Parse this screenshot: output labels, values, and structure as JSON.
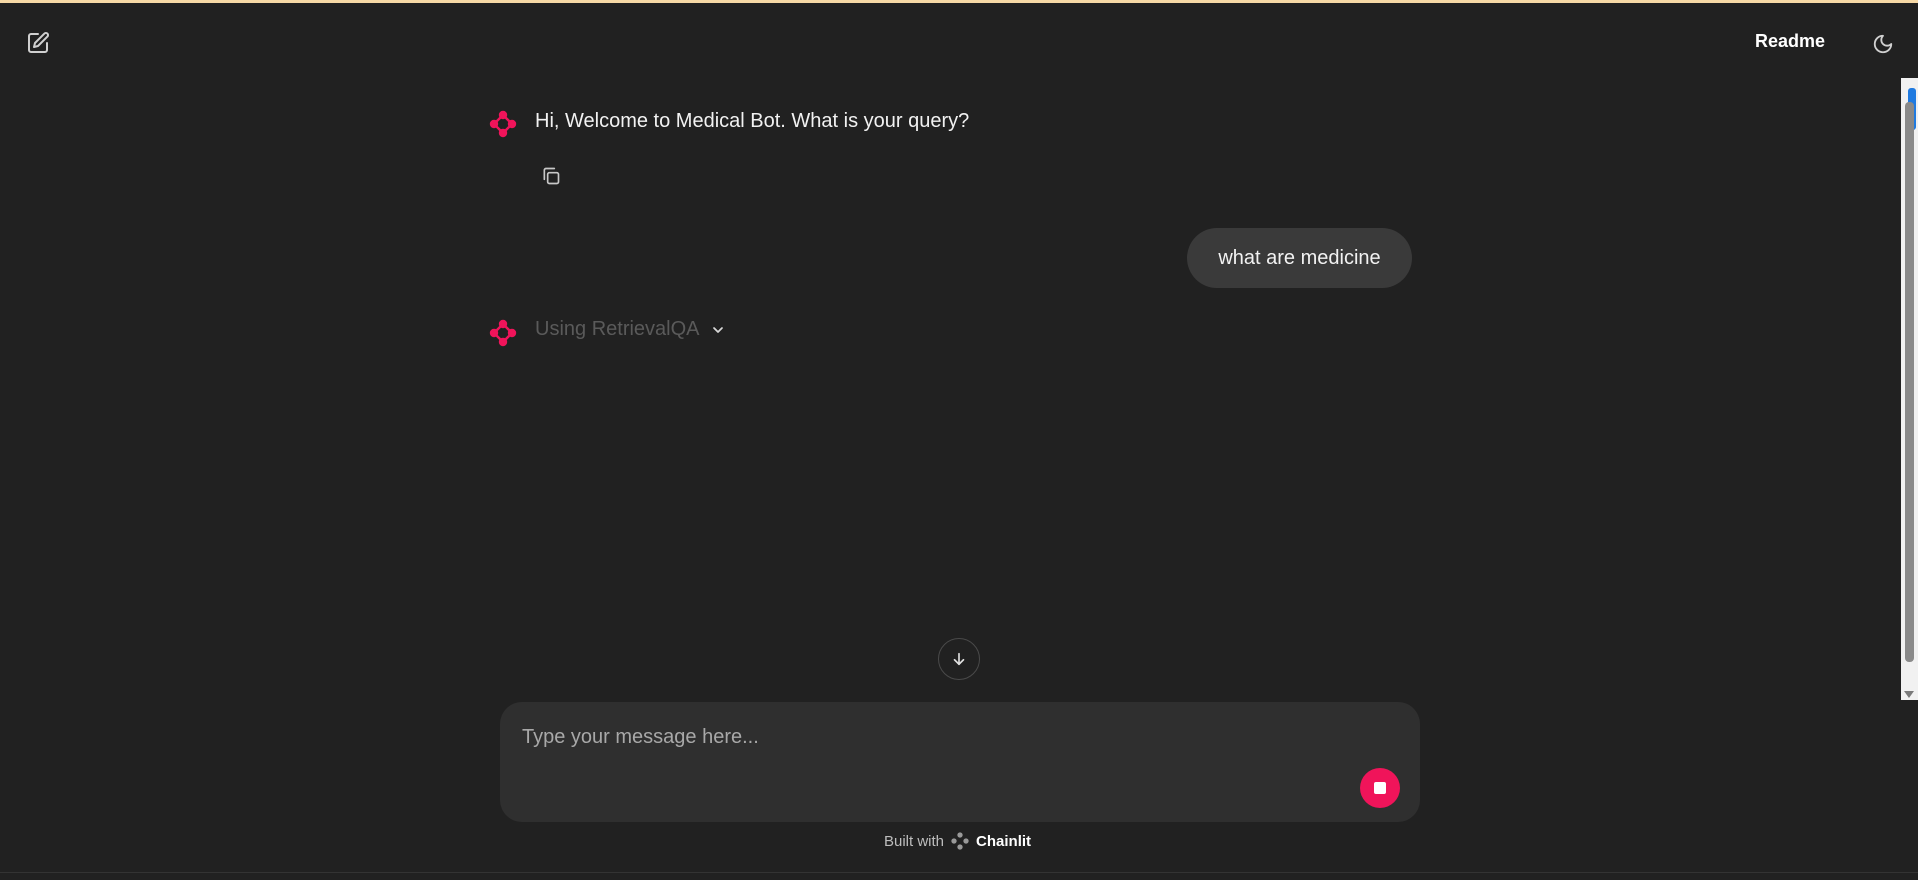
{
  "header": {
    "readme_label": "Readme"
  },
  "icons": {
    "new_chat": "edit-icon",
    "theme": "moon-icon",
    "copy": "copy-icon",
    "chevron": "chevron-down-icon",
    "scroll_down": "arrow-down-icon",
    "stop": "stop-icon",
    "bot_avatar": "chainlit-logo-icon"
  },
  "messages": [
    {
      "author": "bot",
      "text": "Hi, Welcome to Medical Bot. What is your query?"
    },
    {
      "author": "user",
      "text": "what are medicine"
    }
  ],
  "step": {
    "label": "Using RetrievalQA"
  },
  "composer": {
    "placeholder": "Type your message here..."
  },
  "footer": {
    "built_with": "Built with",
    "brand": "Chainlit"
  },
  "colors": {
    "background": "#212121",
    "accent": "#f0145a",
    "bubble": "#3a3a3a",
    "composer": "#2f2f2f"
  }
}
